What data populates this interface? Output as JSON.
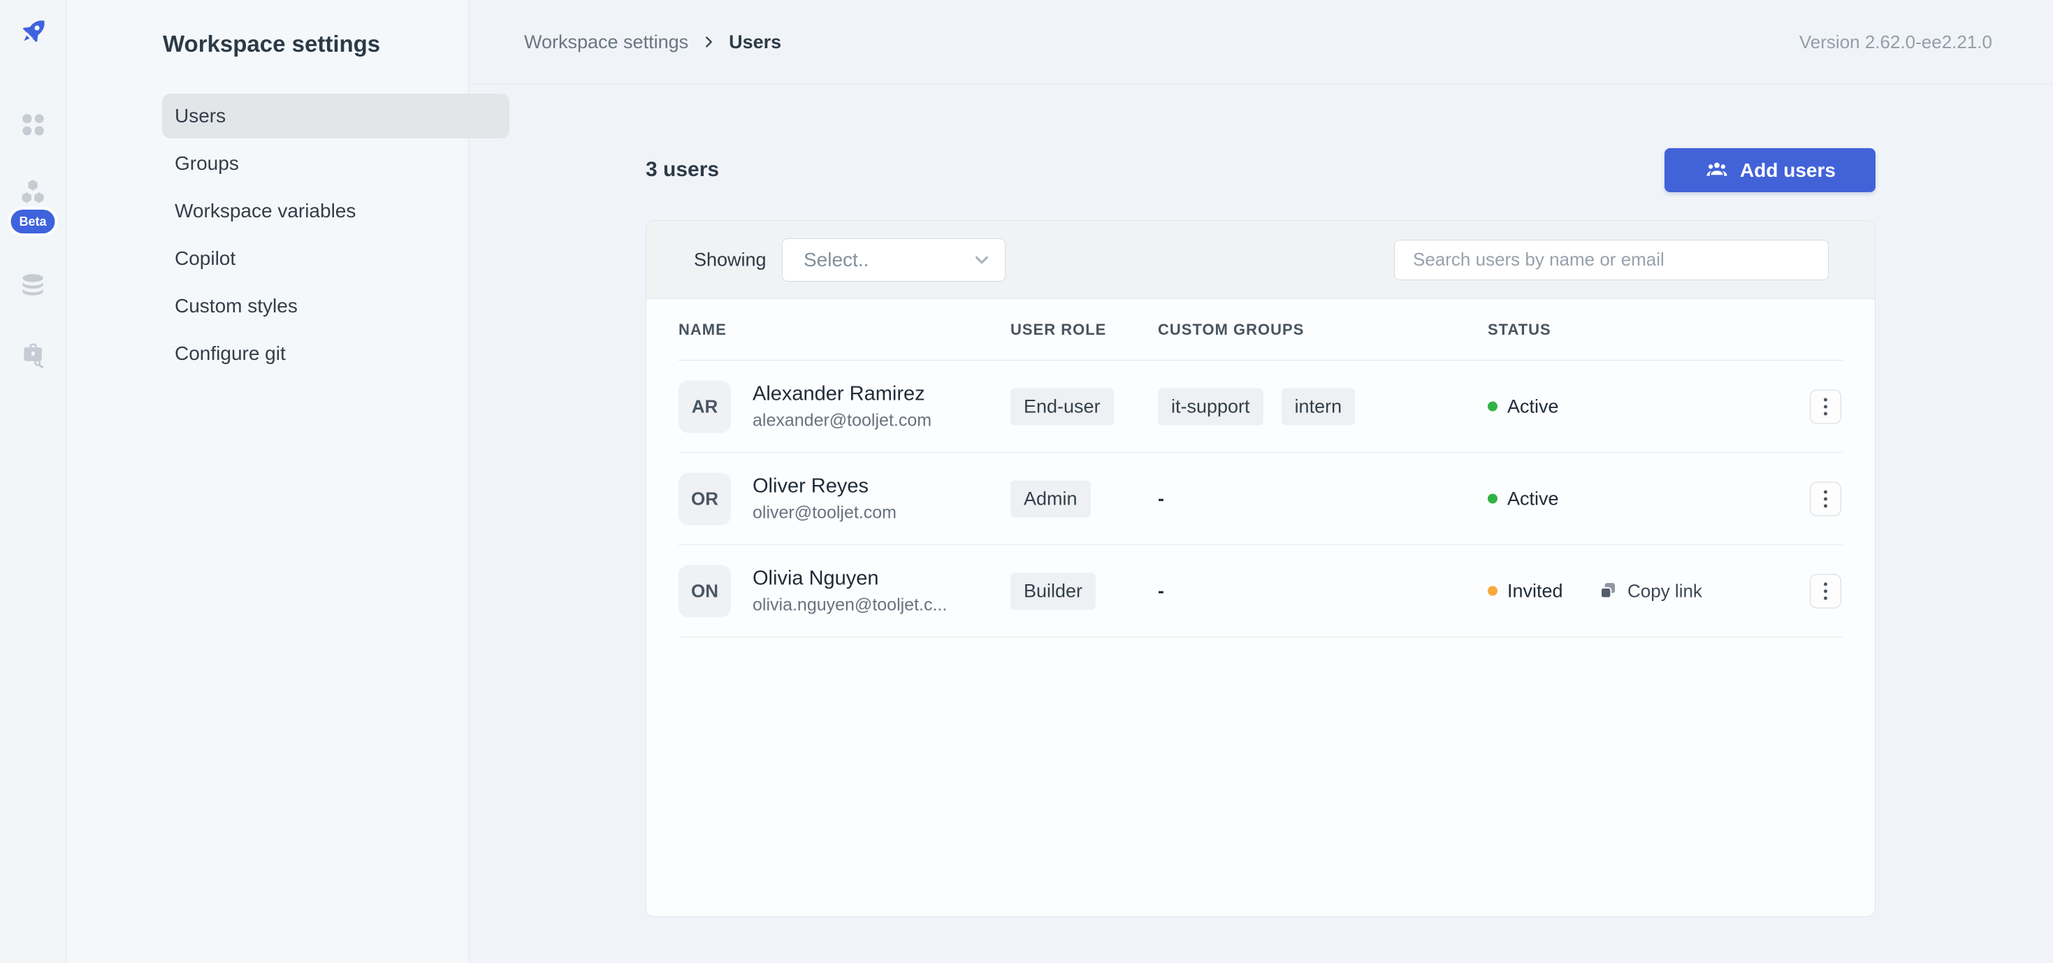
{
  "colors": {
    "primary": "#4262d8",
    "brand": "#3e63dd",
    "active_dot": "#2fb344",
    "invited_dot": "#f7a93b"
  },
  "rail": {
    "beta_label": "Beta"
  },
  "sidebar": {
    "title": "Workspace settings",
    "items": [
      {
        "label": "Users"
      },
      {
        "label": "Groups"
      },
      {
        "label": "Workspace variables"
      },
      {
        "label": "Copilot"
      },
      {
        "label": "Custom styles"
      },
      {
        "label": "Configure git"
      }
    ]
  },
  "breadcrumb": {
    "root": "Workspace settings",
    "current": "Users"
  },
  "header": {
    "version": "Version 2.62.0-ee2.21.0"
  },
  "toolbar": {
    "count": "3 users",
    "add_users": "Add users"
  },
  "filters": {
    "showing": "Showing",
    "select_value": "Select..",
    "search_placeholder": "Search users by name or email"
  },
  "table": {
    "headers": [
      "NAME",
      "USER ROLE",
      "CUSTOM GROUPS",
      "STATUS"
    ],
    "rows": [
      {
        "initials": "AR",
        "name": "Alexander Ramirez",
        "email": "alexander@tooljet.com",
        "role": "End-user",
        "groups": [
          "it-support",
          "intern"
        ],
        "status": "Active",
        "status_color": "#2fb344"
      },
      {
        "initials": "OR",
        "name": "Oliver Reyes",
        "email": "oliver@tooljet.com",
        "role": "Admin",
        "groups_display": "-",
        "status": "Active",
        "status_color": "#2fb344"
      },
      {
        "initials": "ON",
        "name": "Olivia Nguyen",
        "email": "olivia.nguyen@tooljet.c...",
        "role": "Builder",
        "groups_display": "-",
        "status": "Invited",
        "status_color": "#f7a93b",
        "copy_link": "Copy link"
      }
    ]
  }
}
